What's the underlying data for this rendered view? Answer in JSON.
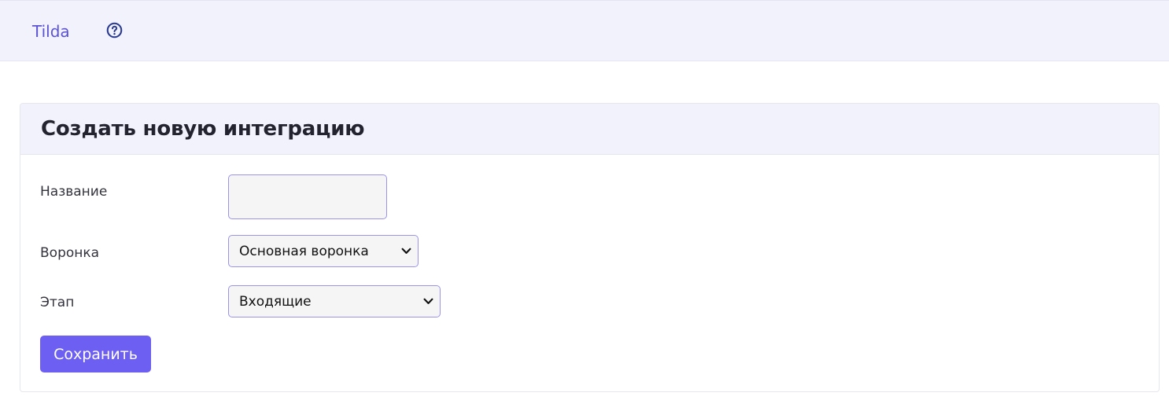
{
  "topbar": {
    "brand": "Tilda",
    "help_icon": "question-circle-icon"
  },
  "form": {
    "title": "Создать новую интеграцию",
    "name_label": "Название",
    "name_value": "",
    "funnel_label": "Воронка",
    "funnel_selected": "Основная воронка",
    "stage_label": "Этап",
    "stage_selected": "Входящие",
    "save_label": "Сохранить"
  },
  "colors": {
    "accent": "#6c5ff2",
    "header_bg": "#f2f2fc",
    "brand_text": "#5b52d6",
    "field_border": "#9a94e6"
  }
}
